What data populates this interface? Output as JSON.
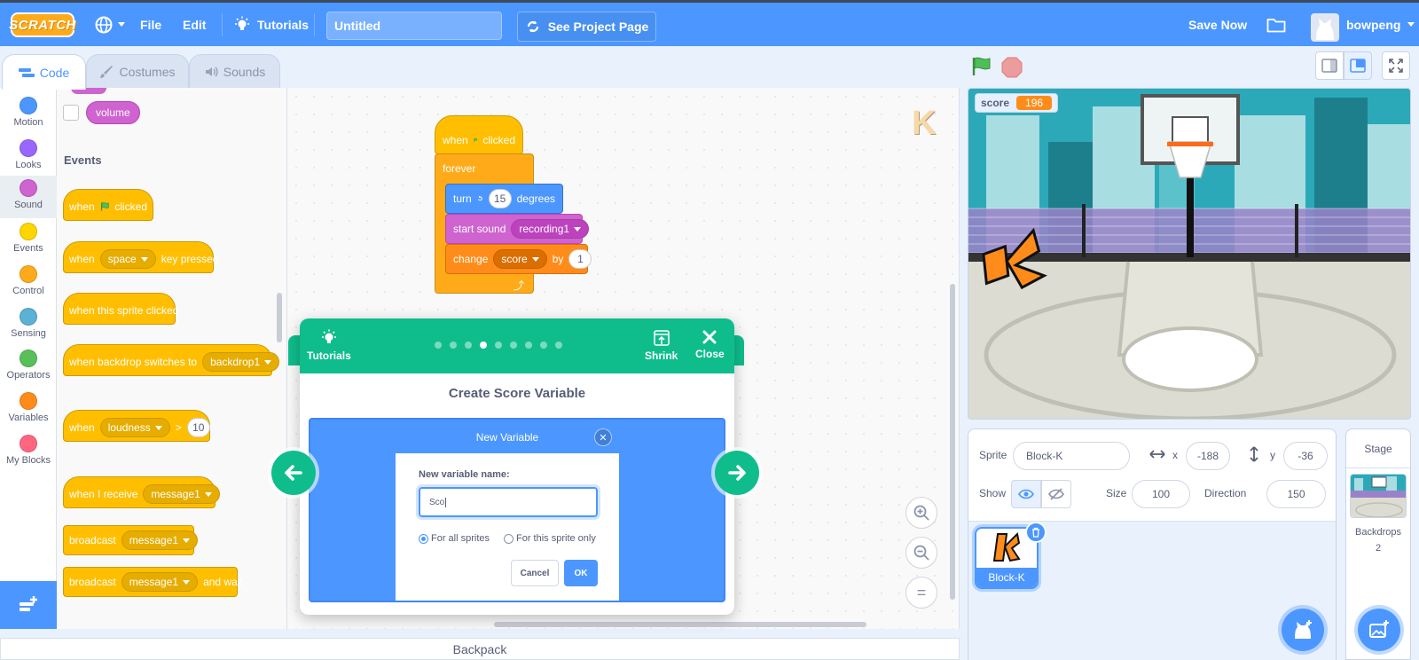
{
  "menubar": {
    "logo": "SCRATCH",
    "file": "File",
    "edit": "Edit",
    "tutorials": "Tutorials",
    "project_title": "Untitled",
    "see_project_page": "See Project Page",
    "save_now": "Save Now",
    "username": "bowpeng"
  },
  "tabs": [
    {
      "label": "Code",
      "active": true
    },
    {
      "label": "Costumes",
      "active": false
    },
    {
      "label": "Sounds",
      "active": false
    }
  ],
  "categories": [
    {
      "label": "Motion",
      "color": "#4c97ff"
    },
    {
      "label": "Looks",
      "color": "#9966ff"
    },
    {
      "label": "Sound",
      "color": "#cf63cf",
      "selected": true
    },
    {
      "label": "Events",
      "color": "#ffd500"
    },
    {
      "label": "Control",
      "color": "#ffab19"
    },
    {
      "label": "Sensing",
      "color": "#5cb1d6"
    },
    {
      "label": "Operators",
      "color": "#59c059"
    },
    {
      "label": "Variables",
      "color": "#ff8c1a"
    },
    {
      "label": "My Blocks",
      "color": "#ff6680"
    }
  ],
  "palette": {
    "volume_reporter": "volume",
    "events_title": "Events",
    "b1": {
      "when": "when",
      "clicked": "clicked"
    },
    "b2": {
      "when": "when",
      "key": "space",
      "pressed": "key pressed"
    },
    "b3": {
      "text": "when this sprite clicked"
    },
    "b4": {
      "text": "when backdrop switches to",
      "value": "backdrop1"
    },
    "b5": {
      "when": "when",
      "sensor": "loudness",
      "op": ">",
      "value": "10"
    },
    "b6": {
      "text": "when I receive",
      "value": "message1"
    },
    "b7": {
      "text": "broadcast",
      "value": "message1"
    },
    "b8": {
      "text": "broadcast",
      "value": "message1",
      "suffix": "and wait"
    }
  },
  "script": {
    "hat": {
      "when": "when",
      "clicked": "clicked"
    },
    "forever": "forever",
    "turn": {
      "label": "turn",
      "value": "15",
      "suffix": "degrees"
    },
    "sound": {
      "label": "start sound",
      "value": "recording1"
    },
    "change": {
      "label": "change",
      "var": "score",
      "by": "by",
      "value": "1"
    }
  },
  "sprite_ghost": "K",
  "zoom": {
    "in": "+",
    "out": "−",
    "reset": "="
  },
  "backpack": "Backpack",
  "stage": {
    "monitor_label": "score",
    "monitor_value": "196"
  },
  "sprite_info": {
    "sprite_label": "Sprite",
    "sprite_name": "Block-K",
    "x_label": "x",
    "x_value": "-188",
    "y_label": "y",
    "y_value": "-36",
    "show_label": "Show",
    "size_label": "Size",
    "size_value": "100",
    "direction_label": "Direction",
    "direction_value": "150",
    "tile_name": "Block-K"
  },
  "stage_panel": {
    "title": "Stage",
    "backdrops_label": "Backdrops",
    "backdrops_count": "2"
  },
  "tutorial": {
    "tutorials_label": "Tutorials",
    "shrink_label": "Shrink",
    "close_label": "Close",
    "title": "Create Score Variable",
    "dots_total": 9,
    "dots_active": 4,
    "dialog": {
      "title": "New Variable",
      "name_label": "New variable name:",
      "name_value": "Sco",
      "opt_all": "For all sprites",
      "opt_this": "For this sprite only",
      "cancel": "Cancel",
      "ok": "OK"
    }
  }
}
